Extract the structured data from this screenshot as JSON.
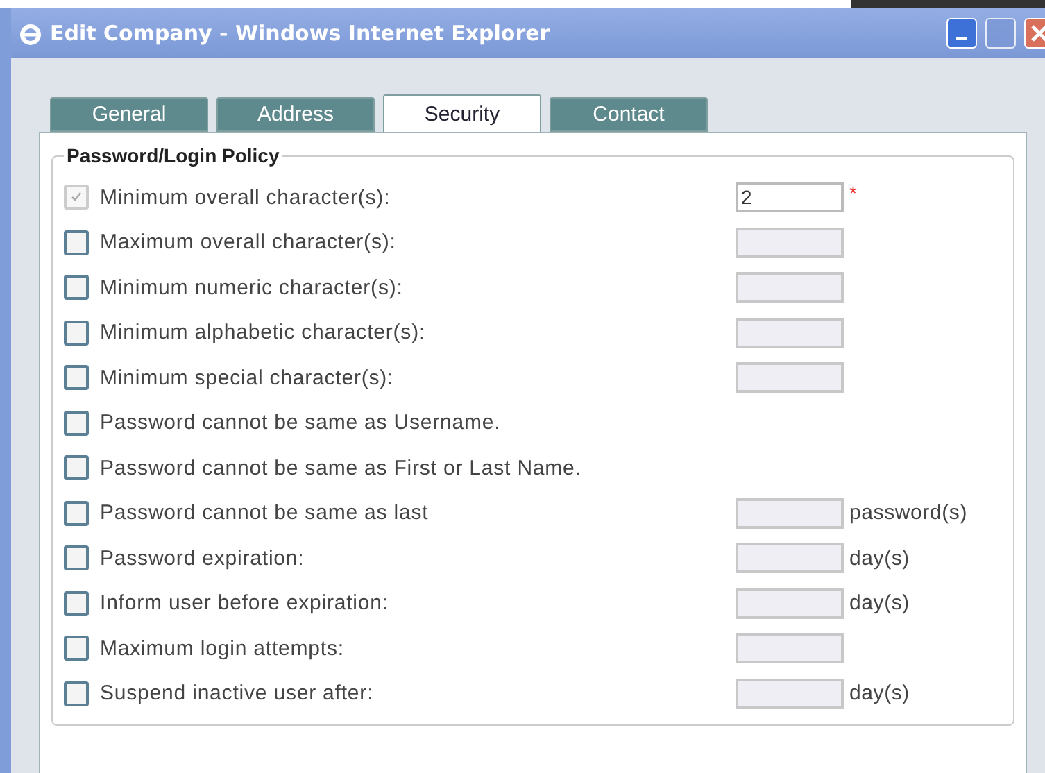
{
  "window": {
    "title": "Edit Company - Windows Internet Explorer"
  },
  "tabs": [
    {
      "label": "General",
      "selected": false
    },
    {
      "label": "Address",
      "selected": false
    },
    {
      "label": "Security",
      "selected": true
    },
    {
      "label": "Contact",
      "selected": false
    }
  ],
  "group": {
    "title": "Password/Login Policy"
  },
  "rules": [
    {
      "label": "Minimum overall character(s):",
      "checked": true,
      "disabled": true,
      "field": {
        "value": "2",
        "disabled": false
      },
      "required_mark": "*"
    },
    {
      "label": "Maximum overall character(s):",
      "checked": false,
      "disabled": false,
      "field": {
        "disabled": true
      }
    },
    {
      "label": "Minimum numeric character(s):",
      "checked": false,
      "disabled": false,
      "field": {
        "disabled": true
      }
    },
    {
      "label": "Minimum alphabetic character(s):",
      "checked": false,
      "disabled": false,
      "field": {
        "disabled": true
      }
    },
    {
      "label": "Minimum special character(s):",
      "checked": false,
      "disabled": false,
      "field": {
        "disabled": true
      }
    },
    {
      "label": "Password cannot be same as Username.",
      "checked": false,
      "disabled": false
    },
    {
      "label": "Password cannot be same as First or Last Name.",
      "checked": false,
      "disabled": false
    },
    {
      "label": "Password cannot be same as last",
      "checked": false,
      "disabled": false,
      "field": {
        "disabled": true
      },
      "suffix": "password(s)"
    },
    {
      "label": "Password expiration:",
      "checked": false,
      "disabled": false,
      "field": {
        "disabled": true
      },
      "suffix": "day(s)"
    },
    {
      "label": "Inform user before expiration:",
      "checked": false,
      "disabled": false,
      "field": {
        "disabled": true
      },
      "suffix": "day(s)"
    },
    {
      "label": "Maximum login attempts:",
      "checked": false,
      "disabled": false,
      "field": {
        "disabled": true
      }
    },
    {
      "label": "Suspend inactive user after:",
      "checked": false,
      "disabled": false,
      "field": {
        "disabled": true
      },
      "suffix": "day(s)"
    }
  ]
}
